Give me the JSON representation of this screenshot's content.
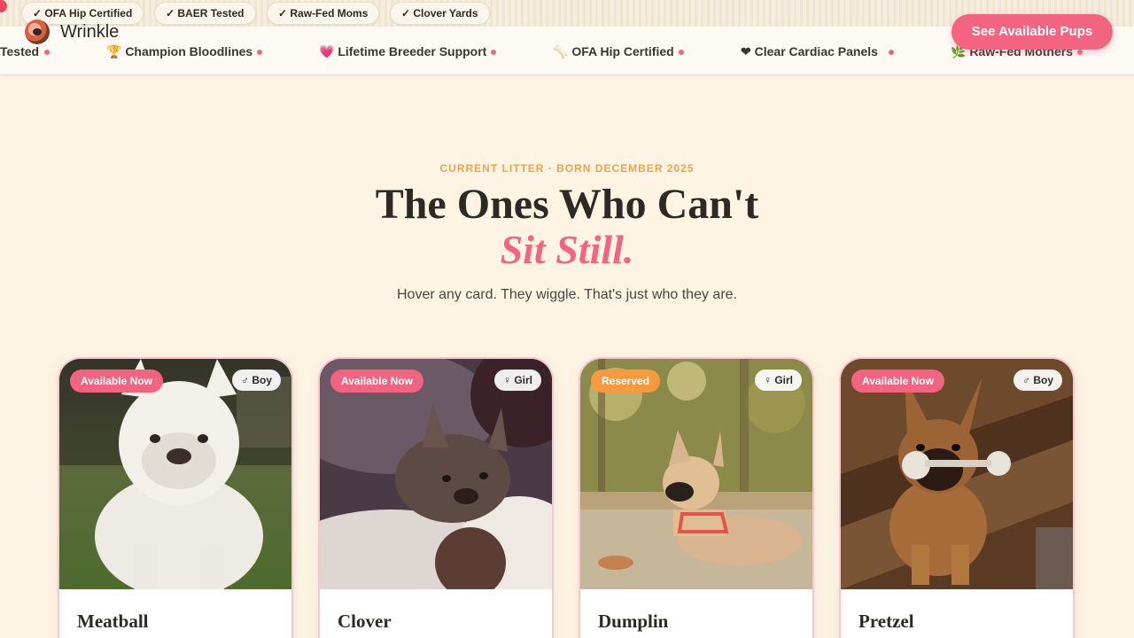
{
  "badges": [
    "✓ OFA Hip Certified",
    "✓ BAER Tested",
    "✓ Raw-Fed Moms",
    "✓ Clover Yards"
  ],
  "brand": {
    "name": "Wrinkle"
  },
  "marquee": [
    "Tested",
    "🏆 Champion Bloodlines",
    "💗 Lifetime Breeder Support",
    "🦴 OFA Hip Certified",
    "❤ Clear Cardiac Panels",
    "🌿 Raw-Fed Mothers"
  ],
  "cta": {
    "label": "See Available Pups"
  },
  "section": {
    "eyebrow": "CURRENT LITTER · BORN DECEMBER 2025",
    "title": "The Ones Who Can't",
    "title_accent": "Sit Still.",
    "subtitle": "Hover any card. They wiggle. That's just who they are."
  },
  "puppies": [
    {
      "name": "Meatball",
      "status": "Available Now",
      "gender": "♂ Boy"
    },
    {
      "name": "Clover",
      "status": "Available Now",
      "gender": "♀ Girl"
    },
    {
      "name": "Dumplin",
      "status": "Reserved",
      "gender": "♀ Girl"
    },
    {
      "name": "Pretzel",
      "status": "Available Now",
      "gender": "♂ Boy"
    }
  ],
  "colors": {
    "accent": "#f2647f",
    "available": "#f2647f",
    "reserved": "#f79a3e",
    "eyebrow": "#f0a34a",
    "background": "#fdf4e3"
  },
  "icons": [
    "check-icon",
    "trophy-icon",
    "heart-icon",
    "bone-icon",
    "leaf-icon",
    "male-icon",
    "female-icon"
  ]
}
